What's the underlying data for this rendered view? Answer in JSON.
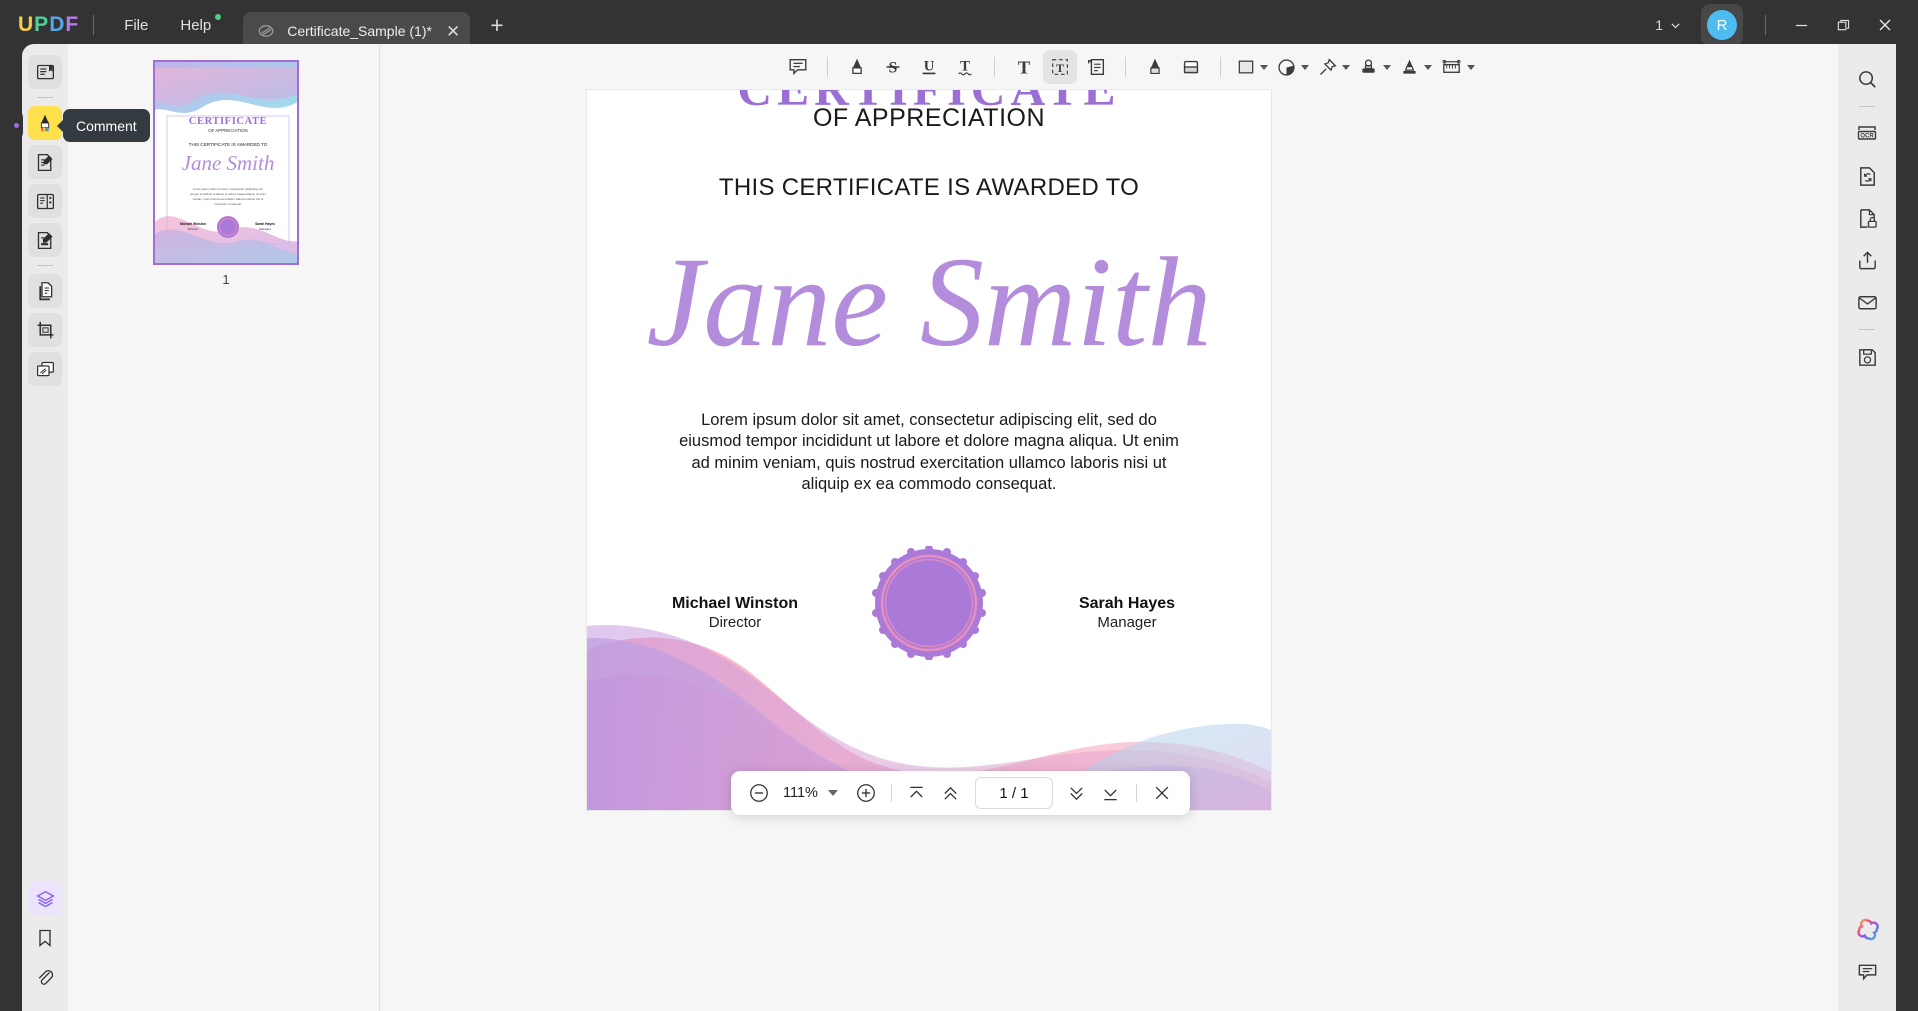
{
  "titlebar": {
    "logo_letters": [
      "U",
      "P",
      "D",
      "F"
    ],
    "menus": [
      {
        "label": "File",
        "has_dot": false
      },
      {
        "label": "Help",
        "has_dot": true
      }
    ],
    "tab": {
      "name": "Certificate_Sample (1)*",
      "icon": "pdf-doc-icon",
      "close_label": "✕"
    },
    "new_tab_label": "+",
    "window_count": "1",
    "avatar_initial": "R",
    "minimize_label": "minimize-icon",
    "restore_label": "restore-icon",
    "close_label": "close-icon"
  },
  "left_rail": {
    "items": [
      {
        "name": "reader-icon",
        "style": "grey"
      },
      {
        "name": "divider",
        "style": "divider"
      },
      {
        "name": "comment-highlighter-icon",
        "style": "active-yellow"
      },
      {
        "name": "edit-pdf-icon",
        "style": "grey"
      },
      {
        "name": "page-organize-icon",
        "style": "grey"
      },
      {
        "name": "form-fill-icon",
        "style": "grey"
      },
      {
        "name": "divider",
        "style": "divider"
      },
      {
        "name": "convert-pages-icon",
        "style": "grey"
      },
      {
        "name": "crop-icon",
        "style": "grey"
      },
      {
        "name": "batch-process-icon",
        "style": "grey"
      }
    ],
    "bottom_items": [
      {
        "name": "layers-icon",
        "style": "active-purple"
      },
      {
        "name": "bookmark-icon",
        "style": "plain"
      },
      {
        "name": "attachment-icon",
        "style": "plain"
      }
    ]
  },
  "tooltip": {
    "text": "Comment"
  },
  "thumbnails": {
    "pages": [
      {
        "number": "1",
        "selected": true
      }
    ]
  },
  "annotation_toolbar": {
    "tools": [
      {
        "name": "comment-icon",
        "label": "Comment",
        "has_caret": false,
        "selected": false
      },
      {
        "name": "separator",
        "label": "",
        "has_caret": false,
        "selected": false
      },
      {
        "name": "highlight-icon",
        "label": "Highlight",
        "has_caret": false,
        "selected": false
      },
      {
        "name": "strikethrough-icon",
        "label": "Strikethrough",
        "has_caret": false,
        "selected": false
      },
      {
        "name": "underline-icon",
        "label": "Underline",
        "has_caret": false,
        "selected": false
      },
      {
        "name": "squiggly-underline-icon",
        "label": "Squiggly",
        "has_caret": false,
        "selected": false
      },
      {
        "name": "separator",
        "label": "",
        "has_caret": false,
        "selected": false
      },
      {
        "name": "text-icon",
        "label": "Text",
        "has_caret": false,
        "selected": false
      },
      {
        "name": "text-box-icon",
        "label": "Text Box",
        "has_caret": false,
        "selected": true
      },
      {
        "name": "sticky-note-icon",
        "label": "Note",
        "has_caret": false,
        "selected": false
      },
      {
        "name": "separator",
        "label": "",
        "has_caret": false,
        "selected": false
      },
      {
        "name": "pencil-icon",
        "label": "Pencil",
        "has_caret": false,
        "selected": false
      },
      {
        "name": "eraser-icon",
        "label": "Eraser",
        "has_caret": false,
        "selected": false
      },
      {
        "name": "separator",
        "label": "",
        "has_caret": false,
        "selected": false
      },
      {
        "name": "shape-square-icon",
        "label": "Shapes",
        "has_caret": true,
        "selected": false
      },
      {
        "name": "shape-circle-icon",
        "label": "Circle",
        "has_caret": true,
        "selected": false
      },
      {
        "name": "pin-icon",
        "label": "Pin",
        "has_caret": true,
        "selected": false
      },
      {
        "name": "stamp-icon",
        "label": "Stamp",
        "has_caret": true,
        "selected": false
      },
      {
        "name": "signature-pen-icon",
        "label": "Signature",
        "has_caret": true,
        "selected": false
      },
      {
        "name": "measure-ruler-icon",
        "label": "Measure",
        "has_caret": true,
        "selected": false
      }
    ]
  },
  "certificate": {
    "title": "CERTIFICATE",
    "subtitle": "OF APPRECIATION",
    "awarded_to_label": "THIS CERTIFICATE IS AWARDED TO",
    "recipient_name": "Jane Smith",
    "body": "Lorem ipsum dolor sit amet, consectetur adipiscing elit, sed do eiusmod tempor incididunt ut labore et dolore magna aliqua. Ut enim ad minim veniam, quis nostrud exercitation ullamco laboris nisi ut aliquip ex ea commodo consequat.",
    "signers": [
      {
        "name": "Michael Winston",
        "role": "Director"
      },
      {
        "name": "Sarah Hayes",
        "role": "Manager"
      }
    ],
    "accent_color": "#9b6fd4",
    "seal_color": "#ab7ad8"
  },
  "bottom_bar": {
    "zoom_out_label": "zoom-out-icon",
    "zoom_value": "111%",
    "zoom_in_label": "zoom-in-icon",
    "first_page_label": "first-page-icon",
    "prev_page_label": "previous-page-icon",
    "page_indicator": "1 / 1",
    "next_page_label": "next-page-icon",
    "last_page_label": "last-page-icon",
    "close_label": "close-icon"
  },
  "right_rail": {
    "items": [
      {
        "name": "search-icon"
      },
      {
        "name": "divider"
      },
      {
        "name": "ocr-icon"
      },
      {
        "name": "convert-icon"
      },
      {
        "name": "protect-lock-icon"
      },
      {
        "name": "share-export-icon"
      },
      {
        "name": "email-icon"
      },
      {
        "name": "divider"
      },
      {
        "name": "save-icon"
      }
    ],
    "bottom_items": [
      {
        "name": "ai-assistant-icon"
      },
      {
        "name": "comment-panel-icon"
      }
    ]
  }
}
